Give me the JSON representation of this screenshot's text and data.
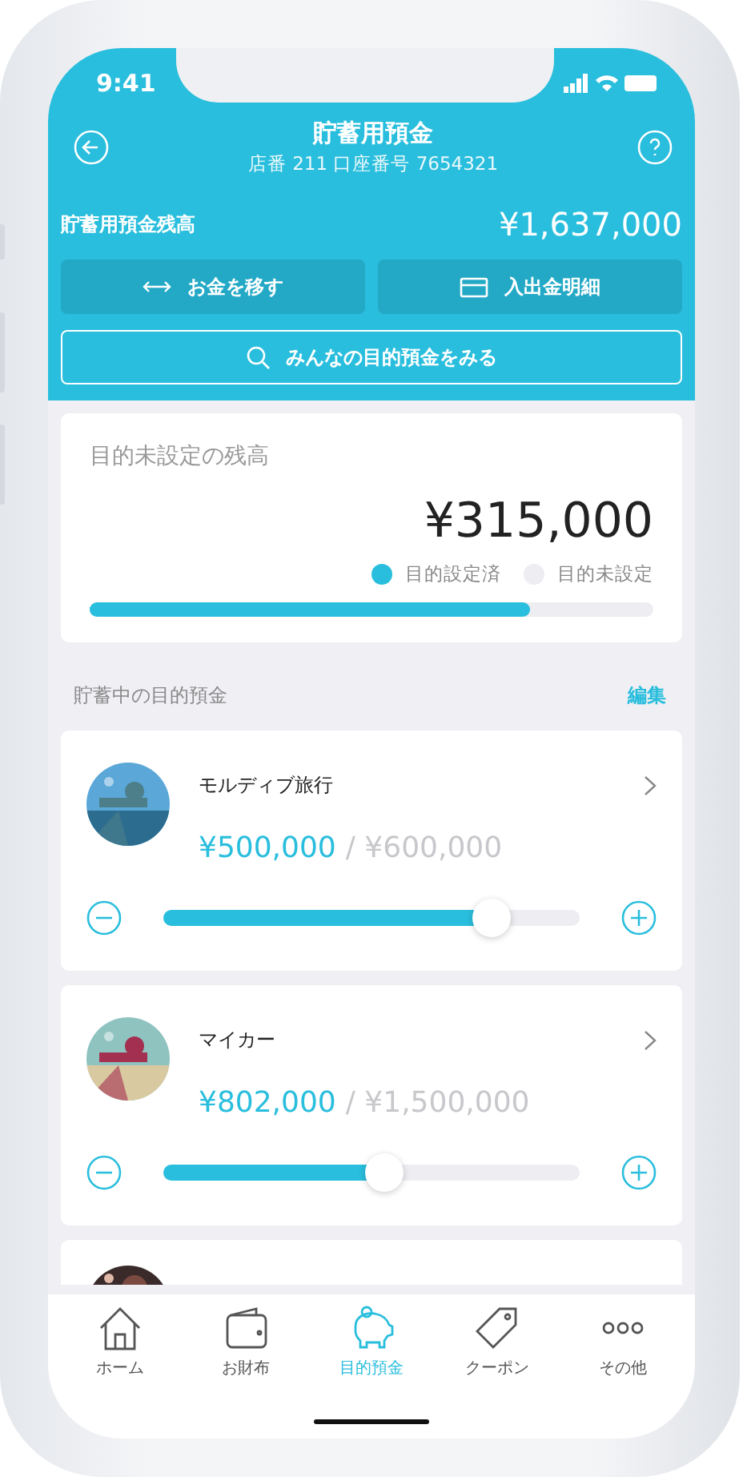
{
  "status_bar": {
    "time": "9:41"
  },
  "header": {
    "title": "貯蓄用預金",
    "subtitle": "店番 211 口座番号 7654321",
    "balance_label": "貯蓄用預金残高",
    "balance": "¥1,637,000"
  },
  "actions": [
    {
      "kind": "transfer",
      "label": "お金を移す"
    },
    {
      "kind": "statement",
      "label": "入出金明細"
    }
  ],
  "search_button": {
    "label": "みんなの目的預金をみる"
  },
  "unassigned": {
    "title": "目的未設定の残高",
    "amount": "¥315,000",
    "legend": [
      {
        "label": "目的設定済",
        "color": "#29bedd"
      },
      {
        "label": "目的未設定",
        "color": "#ededf2"
      }
    ],
    "level": 0.78
  },
  "section": {
    "title": "貯蓄中の目的預金",
    "edit": "編集"
  },
  "goals": [
    {
      "name": "モルディブ旅行",
      "saved": "¥500,000",
      "target": "/ ¥600,000",
      "level": 0.79,
      "kind": "picture"
    },
    {
      "name": "マイカー",
      "saved": "¥802,000",
      "target": "/ ¥1,500,000",
      "level": 0.53,
      "kind": "picture"
    },
    {
      "kind": "picture"
    }
  ],
  "tabs": [
    {
      "kind": "home",
      "label": "ホーム",
      "selected": false
    },
    {
      "kind": "wallet",
      "label": "お財布",
      "selected": false
    },
    {
      "kind": "piggy",
      "label": "目的預金",
      "selected": true
    },
    {
      "kind": "tag",
      "label": "クーポン",
      "selected": false
    },
    {
      "kind": "more",
      "label": "その他",
      "selected": false
    }
  ]
}
